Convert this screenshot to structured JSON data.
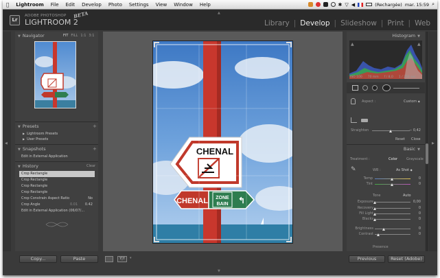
{
  "menubar": {
    "apple": "",
    "app": "Lightroom",
    "items": [
      "File",
      "Edit",
      "Develop",
      "Photo",
      "Settings",
      "View",
      "Window",
      "Help"
    ],
    "battery": "(Rechargée)",
    "clock": "mar. 15:59"
  },
  "identity": {
    "line1": "ADOBE PHOTOSHOP",
    "line2": "LIGHTROOM 2",
    "beta": "BETA",
    "logo": "Lr"
  },
  "modules": [
    "Library",
    "Develop",
    "Slideshow",
    "Print",
    "Web"
  ],
  "active_module": "Develop",
  "navigator": {
    "title": "Navigator",
    "zoom": [
      "FIT",
      "FILL",
      "1:1",
      "3:1"
    ]
  },
  "presets": {
    "title": "Presets",
    "add": "+",
    "items": [
      "Lightroom Presets",
      "User Presets"
    ]
  },
  "snapshots": {
    "title": "Snapshots",
    "add": "+",
    "items": [
      "Edit in External Application"
    ]
  },
  "history": {
    "title": "History",
    "clear": "Clear",
    "items": [
      {
        "label": "Crop Rectangle",
        "a": "",
        "b": "",
        "selected": true
      },
      {
        "label": "Crop Rectangle",
        "a": "",
        "b": ""
      },
      {
        "label": "Crop Rectangle",
        "a": "",
        "b": ""
      },
      {
        "label": "Crop Rectangle",
        "a": "",
        "b": ""
      },
      {
        "label": "Crop Constrain Aspect Ratio",
        "a": "",
        "b": "No"
      },
      {
        "label": "Crop Angle",
        "a": "0.01",
        "b": "0.42"
      },
      {
        "label": "Edit in External Application (06/07/...",
        "a": "",
        "b": ""
      }
    ]
  },
  "left_buttons": {
    "copy": "Copy...",
    "paste": "Paste"
  },
  "photo": {
    "sign_top": "CHENAL",
    "sign_bottom_left": "CHENAL",
    "sign_bottom_right_1": "ZONE",
    "sign_bottom_right_2": "BAIN",
    "sign_arrow": "ʃ"
  },
  "histogram": {
    "title": "Histogram",
    "info": [
      "ISO 100",
      "70 mm",
      "f / 8,0",
      "1 / 250 sec"
    ]
  },
  "crop": {
    "label": "Aspect :",
    "value": "Custom",
    "straighten_label": "Straighten",
    "straighten_value": "− 0,42",
    "reset": "Reset",
    "close": "Close"
  },
  "basic": {
    "title": "Basic",
    "treatment_label": "Treatment :",
    "color": "Color",
    "grayscale": "Grayscale",
    "wb_label": "WB :",
    "wb_value": "As Shot",
    "temp": {
      "label": "Temp",
      "value": "0"
    },
    "tint": {
      "label": "Tint",
      "value": "0"
    },
    "tone_label": "Tone",
    "auto": "Auto",
    "sliders": [
      {
        "label": "Exposure",
        "value": "0,00"
      },
      {
        "label": "Recovery",
        "value": "0"
      },
      {
        "label": "Fill Light",
        "value": "0"
      },
      {
        "label": "Blacks",
        "value": "0"
      },
      {
        "label": "Brightness",
        "value": "0"
      },
      {
        "label": "Contrast",
        "value": "0"
      }
    ],
    "presence": "Presence"
  },
  "right_buttons": {
    "previous": "Previous",
    "reset": "Reset (Adobe)"
  },
  "toolbar": {
    "view1": "",
    "view2": "Y|Y"
  },
  "colors": {
    "panel": "#404040",
    "bg": "#3a3a3a",
    "sign_red": "#c0392b",
    "sign_green": "#2e7d4f",
    "pole": "#c8372d"
  }
}
